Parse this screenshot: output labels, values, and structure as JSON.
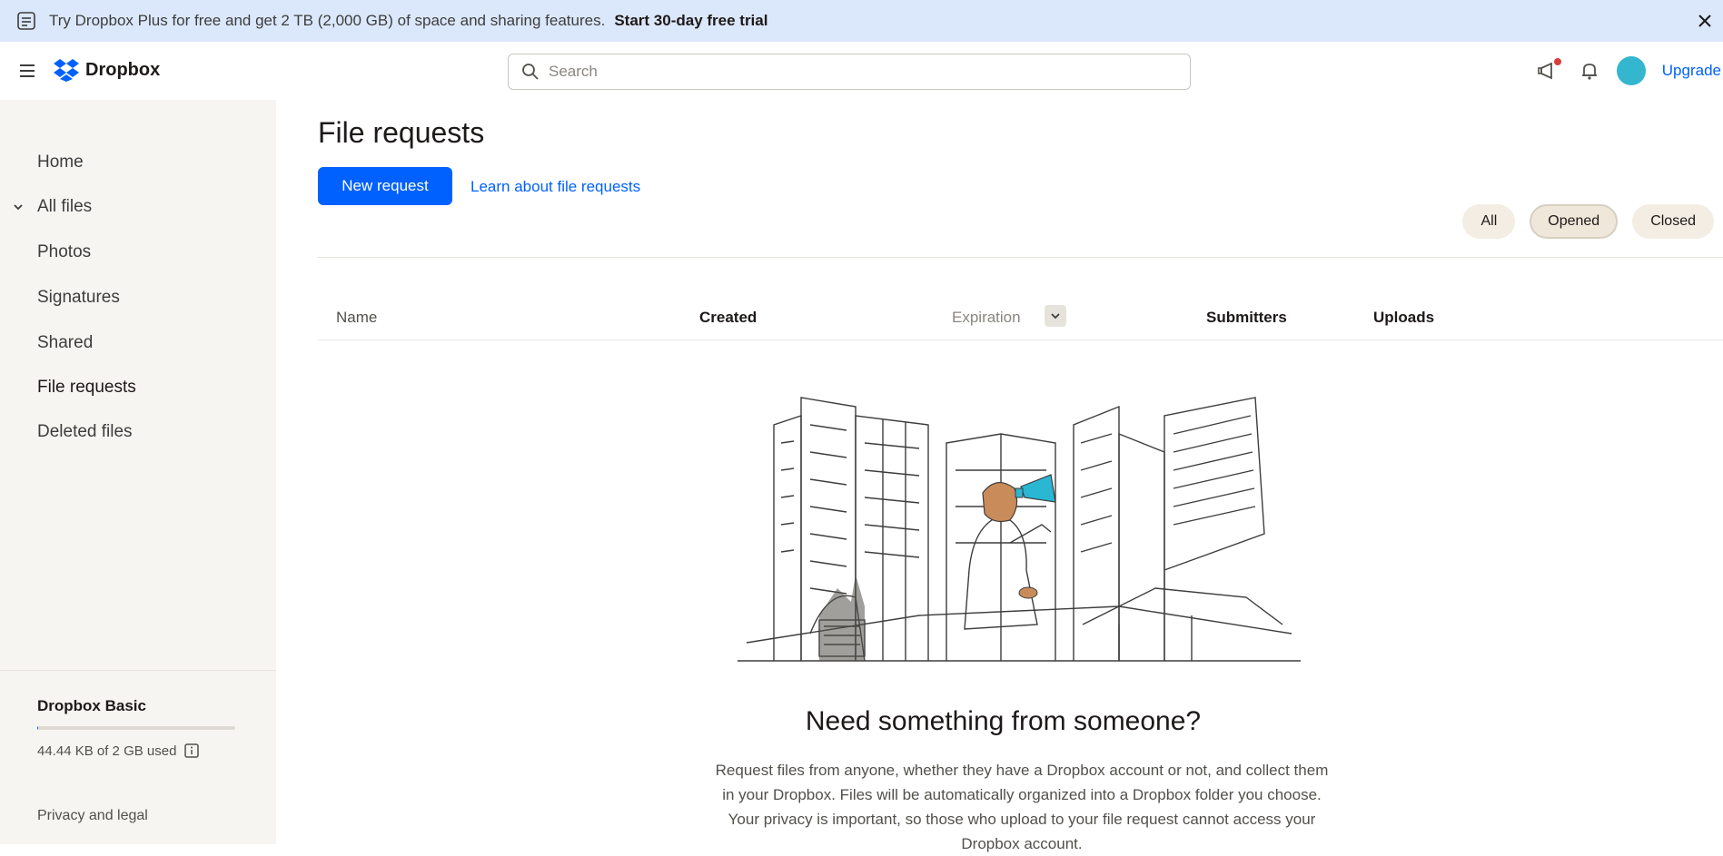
{
  "banner": {
    "text": "Try Dropbox Plus for free and get 2 TB (2,000 GB) of space and sharing features.",
    "cta": "Start 30-day free trial"
  },
  "header": {
    "logo_text": "Dropbox",
    "search_placeholder": "Search",
    "upgrade_label": "Upgrade"
  },
  "sidebar": {
    "items": [
      {
        "label": "Home"
      },
      {
        "label": "All files"
      },
      {
        "label": "Photos"
      },
      {
        "label": "Signatures"
      },
      {
        "label": "Shared"
      },
      {
        "label": "File requests"
      },
      {
        "label": "Deleted files"
      }
    ],
    "plan_name": "Dropbox Basic",
    "usage_fraction": 0.0,
    "usage_text": "44.44 KB of 2 GB used",
    "privacy_label": "Privacy and legal"
  },
  "main": {
    "title": "File requests",
    "new_request_label": "New request",
    "learn_link": "Learn about file requests",
    "filters": [
      {
        "label": "All"
      },
      {
        "label": "Opened"
      },
      {
        "label": "Closed"
      }
    ],
    "selected_filter": "Opened",
    "columns": {
      "name": "Name",
      "created": "Created",
      "expiration": "Expiration",
      "submitters": "Submitters",
      "uploads": "Uploads"
    },
    "empty_title": "Need something from someone?",
    "empty_body": "Request files from anyone, whether they have a Dropbox account or not, and collect them in your Dropbox. Files will be automatically organized into a Dropbox folder you choose. Your privacy is important, so those who upload to your file request cannot access your Dropbox account."
  },
  "colors": {
    "accent": "#0061fe",
    "banner_bg": "#dbe8fb",
    "sidebar_bg": "#f7f5f2",
    "chip_bg": "#f3ede3",
    "illustration_accent": "#2ab7d4",
    "illustration_skin": "#c98b5a"
  },
  "icons": {
    "banner": "info-icon",
    "close": "close-icon",
    "menu": "hamburger-menu-icon",
    "search": "search-icon",
    "notifications": "megaphone-icon",
    "bell": "bell-icon"
  }
}
